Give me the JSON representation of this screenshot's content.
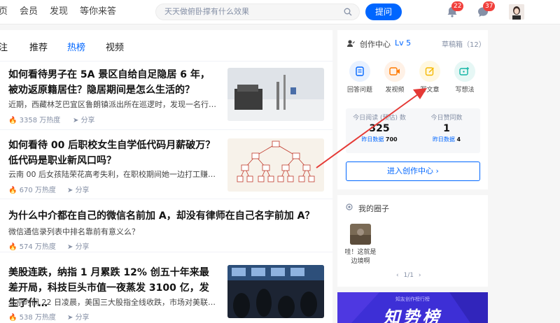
{
  "header": {
    "nav": [
      "页",
      "会员",
      "发现",
      "等你来答"
    ],
    "search_placeholder": "天天做俯卧撑有什么效果",
    "ask_label": "提问",
    "notifications_count": "22",
    "messages_count": "37"
  },
  "feed": {
    "tabs": [
      "注",
      "推荐",
      "热榜",
      "视频"
    ],
    "active_tab": "热榜",
    "items": [
      {
        "title": "如何看待男子在 5A 景区自给自足隐居 6 年，被劝返原籍居住？隐居期间是怎么生活的？",
        "excerpt": "近期，西藏林芝巴宜区鲁朗镇派出所在巡逻时，发现一名行…",
        "heat": "3358 万热度",
        "share": "分享"
      },
      {
        "title": "如何看待 00 后职校女生自学低代码月薪破万？低代码是职业新风口吗？",
        "excerpt": "云南 00 后女孩陆荣花高考失利，在职校期间她一边打工赚学…",
        "heat": "670 万热度",
        "share": "分享"
      },
      {
        "title": "为什么中介都在自己的微信名前加 A，却没有律师在自己名字前加 A？",
        "excerpt": "微信通信录列表中排名靠前有意义么？",
        "heat": "574 万热度",
        "share": "分享"
      },
      {
        "title": "美股连跌，纳指 1 月累跌 12% 创五十年来最差开局，科技巨头市值一夜蒸发 3100 亿，发生了什…",
        "excerpt": "北京时间 22 日凌晨，美国三大股指全线收跌，市场对美联储…",
        "heat": "538 万热度",
        "share": "分享"
      }
    ]
  },
  "creator": {
    "title": "创作中心",
    "level": "Lv 5",
    "drafts": "草稿箱（12）",
    "tools": [
      "回答问题",
      "发视频",
      "写文章",
      "写想法"
    ],
    "stats": [
      {
        "label": "今日阅读 (预估) 数",
        "value": "325",
        "sub_label": "昨日数据",
        "sub_value": "700"
      },
      {
        "label": "今日赞同数",
        "value": "1",
        "sub_label": "昨日数据",
        "sub_value": "4"
      }
    ],
    "enter_label": "进入创作中心 ›"
  },
  "circles": {
    "title": "我的圈子",
    "items": [
      {
        "name": "哇！这就是边境啊"
      }
    ],
    "pager": "1/1"
  },
  "banner": {
    "small_text": "知友创作榜行榜",
    "big_text": "知势榜"
  },
  "colors": {
    "brand": "#0066ff",
    "badge": "#f1403c",
    "annotation_arrow": "#e53935"
  }
}
